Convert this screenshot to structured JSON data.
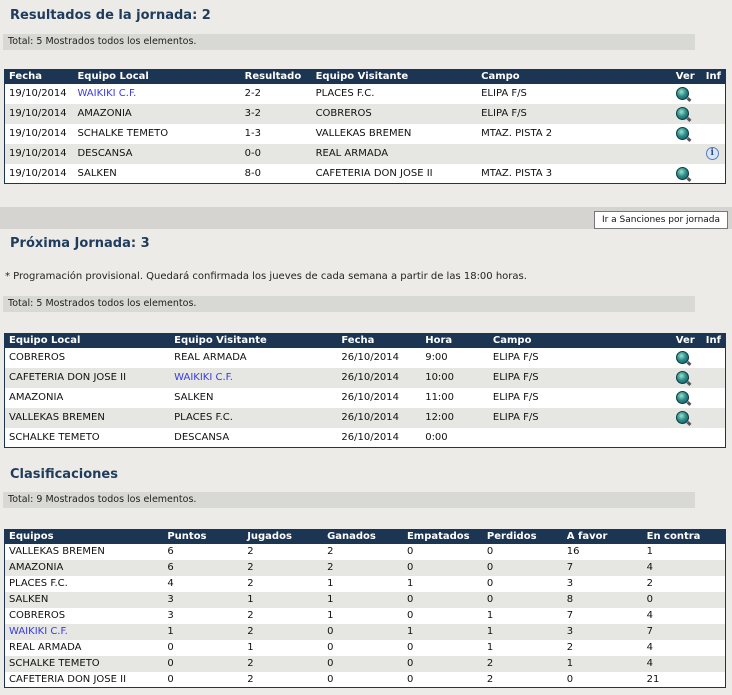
{
  "jornada": {
    "title": "Resultados de la jornada: 2",
    "total_text": "Total: 5 Mostrados todos los elementos.",
    "headers": [
      "Fecha",
      "Equipo Local",
      "Resultado",
      "Equipo Visitante",
      "Campo",
      "Ver",
      "Inf"
    ],
    "rows": [
      {
        "fecha": "19/10/2014",
        "local": "WAIKIKI C.F.",
        "resultado": "2-2",
        "visitante": "PLACES F.C.",
        "campo": "ELIPA F/S"
      },
      {
        "fecha": "19/10/2014",
        "local": "AMAZONIA",
        "resultado": "3-2",
        "visitante": "COBREROS",
        "campo": "ELIPA F/S"
      },
      {
        "fecha": "19/10/2014",
        "local": "SCHALKE TEMETO",
        "resultado": "1-3",
        "visitante": "VALLEKAS BREMEN",
        "campo": "MTAZ. PISTA 2"
      },
      {
        "fecha": "19/10/2014",
        "local": "DESCANSA",
        "resultado": "0-0",
        "visitante": "REAL ARMADA",
        "campo": ""
      },
      {
        "fecha": "19/10/2014",
        "local": "SALKEN",
        "resultado": "8-0",
        "visitante": "CAFETERIA DON JOSE II",
        "campo": "MTAZ. PISTA 3"
      }
    ]
  },
  "sanciones_button": "Ir a Sanciones por jornada",
  "proxima": {
    "title": "Próxima Jornada: 3",
    "note": "* Programación provisional. Quedará confirmada los jueves de cada semana a partir de las 18:00 horas.",
    "total_text": "Total: 5 Mostrados todos los elementos.",
    "headers": [
      "Equipo Local",
      "Equipo Visitante",
      "Fecha",
      "Hora",
      "Campo",
      "Ver",
      "Inf"
    ],
    "rows": [
      {
        "local": "COBREROS",
        "visitante": "REAL ARMADA",
        "fecha": "26/10/2014",
        "hora": "9:00",
        "campo": "ELIPA F/S"
      },
      {
        "local": "CAFETERIA DON JOSE II",
        "visitante": "WAIKIKI C.F.",
        "fecha": "26/10/2014",
        "hora": "10:00",
        "campo": "ELIPA F/S"
      },
      {
        "local": "AMAZONIA",
        "visitante": "SALKEN",
        "fecha": "26/10/2014",
        "hora": "11:00",
        "campo": "ELIPA F/S"
      },
      {
        "local": "VALLEKAS BREMEN",
        "visitante": "PLACES F.C.",
        "fecha": "26/10/2014",
        "hora": "12:00",
        "campo": "ELIPA F/S"
      },
      {
        "local": "SCHALKE TEMETO",
        "visitante": "DESCANSA",
        "fecha": "26/10/2014",
        "hora": "0:00",
        "campo": ""
      }
    ]
  },
  "clasificaciones": {
    "title": "Clasificaciones",
    "total_text": "Total: 9 Mostrados todos los elementos.",
    "headers": [
      "Equipos",
      "Puntos",
      "Jugados",
      "Ganados",
      "Empatados",
      "Perdidos",
      "A favor",
      "En contra"
    ],
    "rows": [
      [
        "VALLEKAS BREMEN",
        "6",
        "2",
        "2",
        "0",
        "0",
        "16",
        "1"
      ],
      [
        "AMAZONIA",
        "6",
        "2",
        "2",
        "0",
        "0",
        "7",
        "4"
      ],
      [
        "PLACES F.C.",
        "4",
        "2",
        "1",
        "1",
        "0",
        "3",
        "2"
      ],
      [
        "SALKEN",
        "3",
        "1",
        "1",
        "0",
        "0",
        "8",
        "0"
      ],
      [
        "COBREROS",
        "3",
        "2",
        "1",
        "0",
        "1",
        "7",
        "4"
      ],
      [
        "WAIKIKI C.F.",
        "1",
        "2",
        "0",
        "1",
        "1",
        "3",
        "7"
      ],
      [
        "REAL ARMADA",
        "0",
        "1",
        "0",
        "0",
        "1",
        "2",
        "4"
      ],
      [
        "SCHALKE TEMETO",
        "0",
        "2",
        "0",
        "0",
        "2",
        "1",
        "4"
      ],
      [
        "CAFETERIA DON JOSE II",
        "0",
        "2",
        "0",
        "0",
        "2",
        "0",
        "21"
      ]
    ]
  },
  "icons": {
    "ver": "view-magnifier-icon",
    "inf": "info-icon"
  },
  "colors": {
    "header_bg": "#1b3553",
    "title": "#1f3c5c",
    "link": "#3b3be0",
    "row_alt": "#e6e6e2"
  }
}
